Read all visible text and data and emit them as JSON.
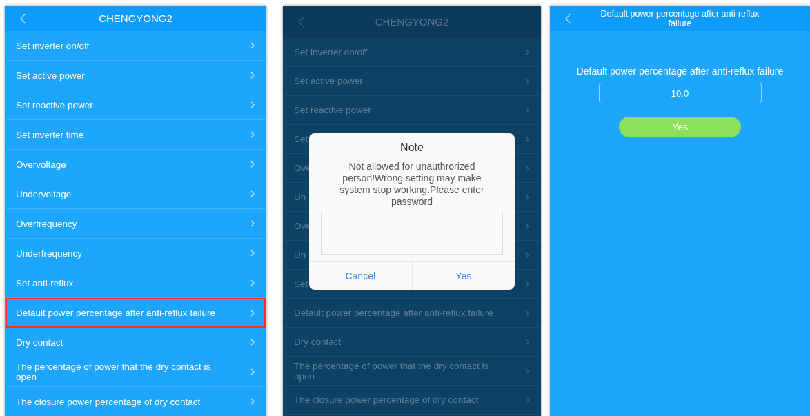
{
  "screens": [
    {
      "kind": "list",
      "title": "CHENGYONG2",
      "items": [
        {
          "label": "Set inverter on/off",
          "selected": false
        },
        {
          "label": "Set active power",
          "selected": false
        },
        {
          "label": "Set reactive power",
          "selected": false
        },
        {
          "label": "Set inverter time",
          "selected": false
        },
        {
          "label": "Overvoltage",
          "selected": false
        },
        {
          "label": "Undervoltage",
          "selected": false
        },
        {
          "label": "Overfrequency",
          "selected": false
        },
        {
          "label": "Underfrequency",
          "selected": false
        },
        {
          "label": "Set anti-reflux",
          "selected": false
        },
        {
          "label": "Default power percentage after anti-reflux failure",
          "selected": true
        },
        {
          "label": "Dry contact",
          "selected": false
        },
        {
          "label": "The percentage of power that the dry contact is open",
          "selected": false
        },
        {
          "label": "The closure power percentage of dry contact",
          "selected": false
        }
      ]
    },
    {
      "kind": "dialog",
      "title": "CHENGYONG2",
      "items": [
        {
          "label": "Set inverter on/off"
        },
        {
          "label": "Set active power"
        },
        {
          "label": "Set reactive power"
        },
        {
          "label": "Set"
        },
        {
          "label": "Ove"
        },
        {
          "label": "Un"
        },
        {
          "label": "Ove"
        },
        {
          "label": "Un"
        },
        {
          "label": "Set"
        },
        {
          "label": "Default power percentage after anti-reflux failure"
        },
        {
          "label": "Dry contact"
        },
        {
          "label": "The percentage of power that the dry contact is open"
        },
        {
          "label": "The closure power percentage of dry contact"
        }
      ],
      "dialog": {
        "title": "Note",
        "message": "Not allowed for unauthrorized person!Wrong setting may make system stop working.Please enter password",
        "buttons": [
          "Cancel",
          "Yes"
        ]
      }
    },
    {
      "kind": "form",
      "title": "Default power percentage after anti-reflux failure",
      "field_label": "Default power percentage after anti-reflux failure",
      "value": "10.0",
      "button": "Yes"
    }
  ]
}
